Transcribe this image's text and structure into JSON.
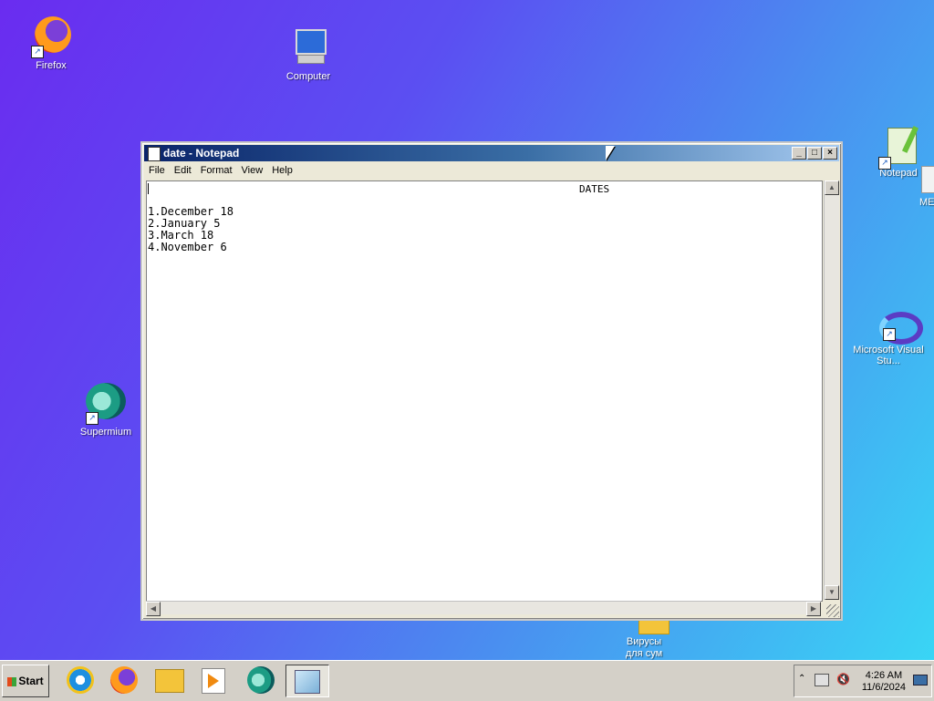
{
  "desktop": {
    "icons": [
      {
        "label": "Firefox"
      },
      {
        "label": "Computer"
      },
      {
        "label": "Supermium"
      },
      {
        "label": "Notepad"
      },
      {
        "label": "ME"
      },
      {
        "label": "Microsoft Visual Stu..."
      },
      {
        "label": "Вирусы для сум"
      }
    ]
  },
  "window": {
    "title": "date - Notepad",
    "menu": [
      "File",
      "Edit",
      "Format",
      "View",
      "Help"
    ],
    "content": {
      "heading": "DATES",
      "lines": [
        "1.December 18",
        "2.January 5",
        "3.March 18",
        "4.November 6"
      ]
    }
  },
  "taskbar": {
    "start_label": "Start",
    "apps": [
      "internet-explorer",
      "firefox",
      "file-explorer",
      "media-player",
      "supermium",
      "notepad"
    ],
    "tray": {
      "time": "4:26 AM",
      "date": "11/6/2024"
    }
  },
  "colors": {
    "titlebar_start": "#0a246a",
    "titlebar_end": "#a6caf0",
    "taskbar": "#d4d0c8"
  }
}
